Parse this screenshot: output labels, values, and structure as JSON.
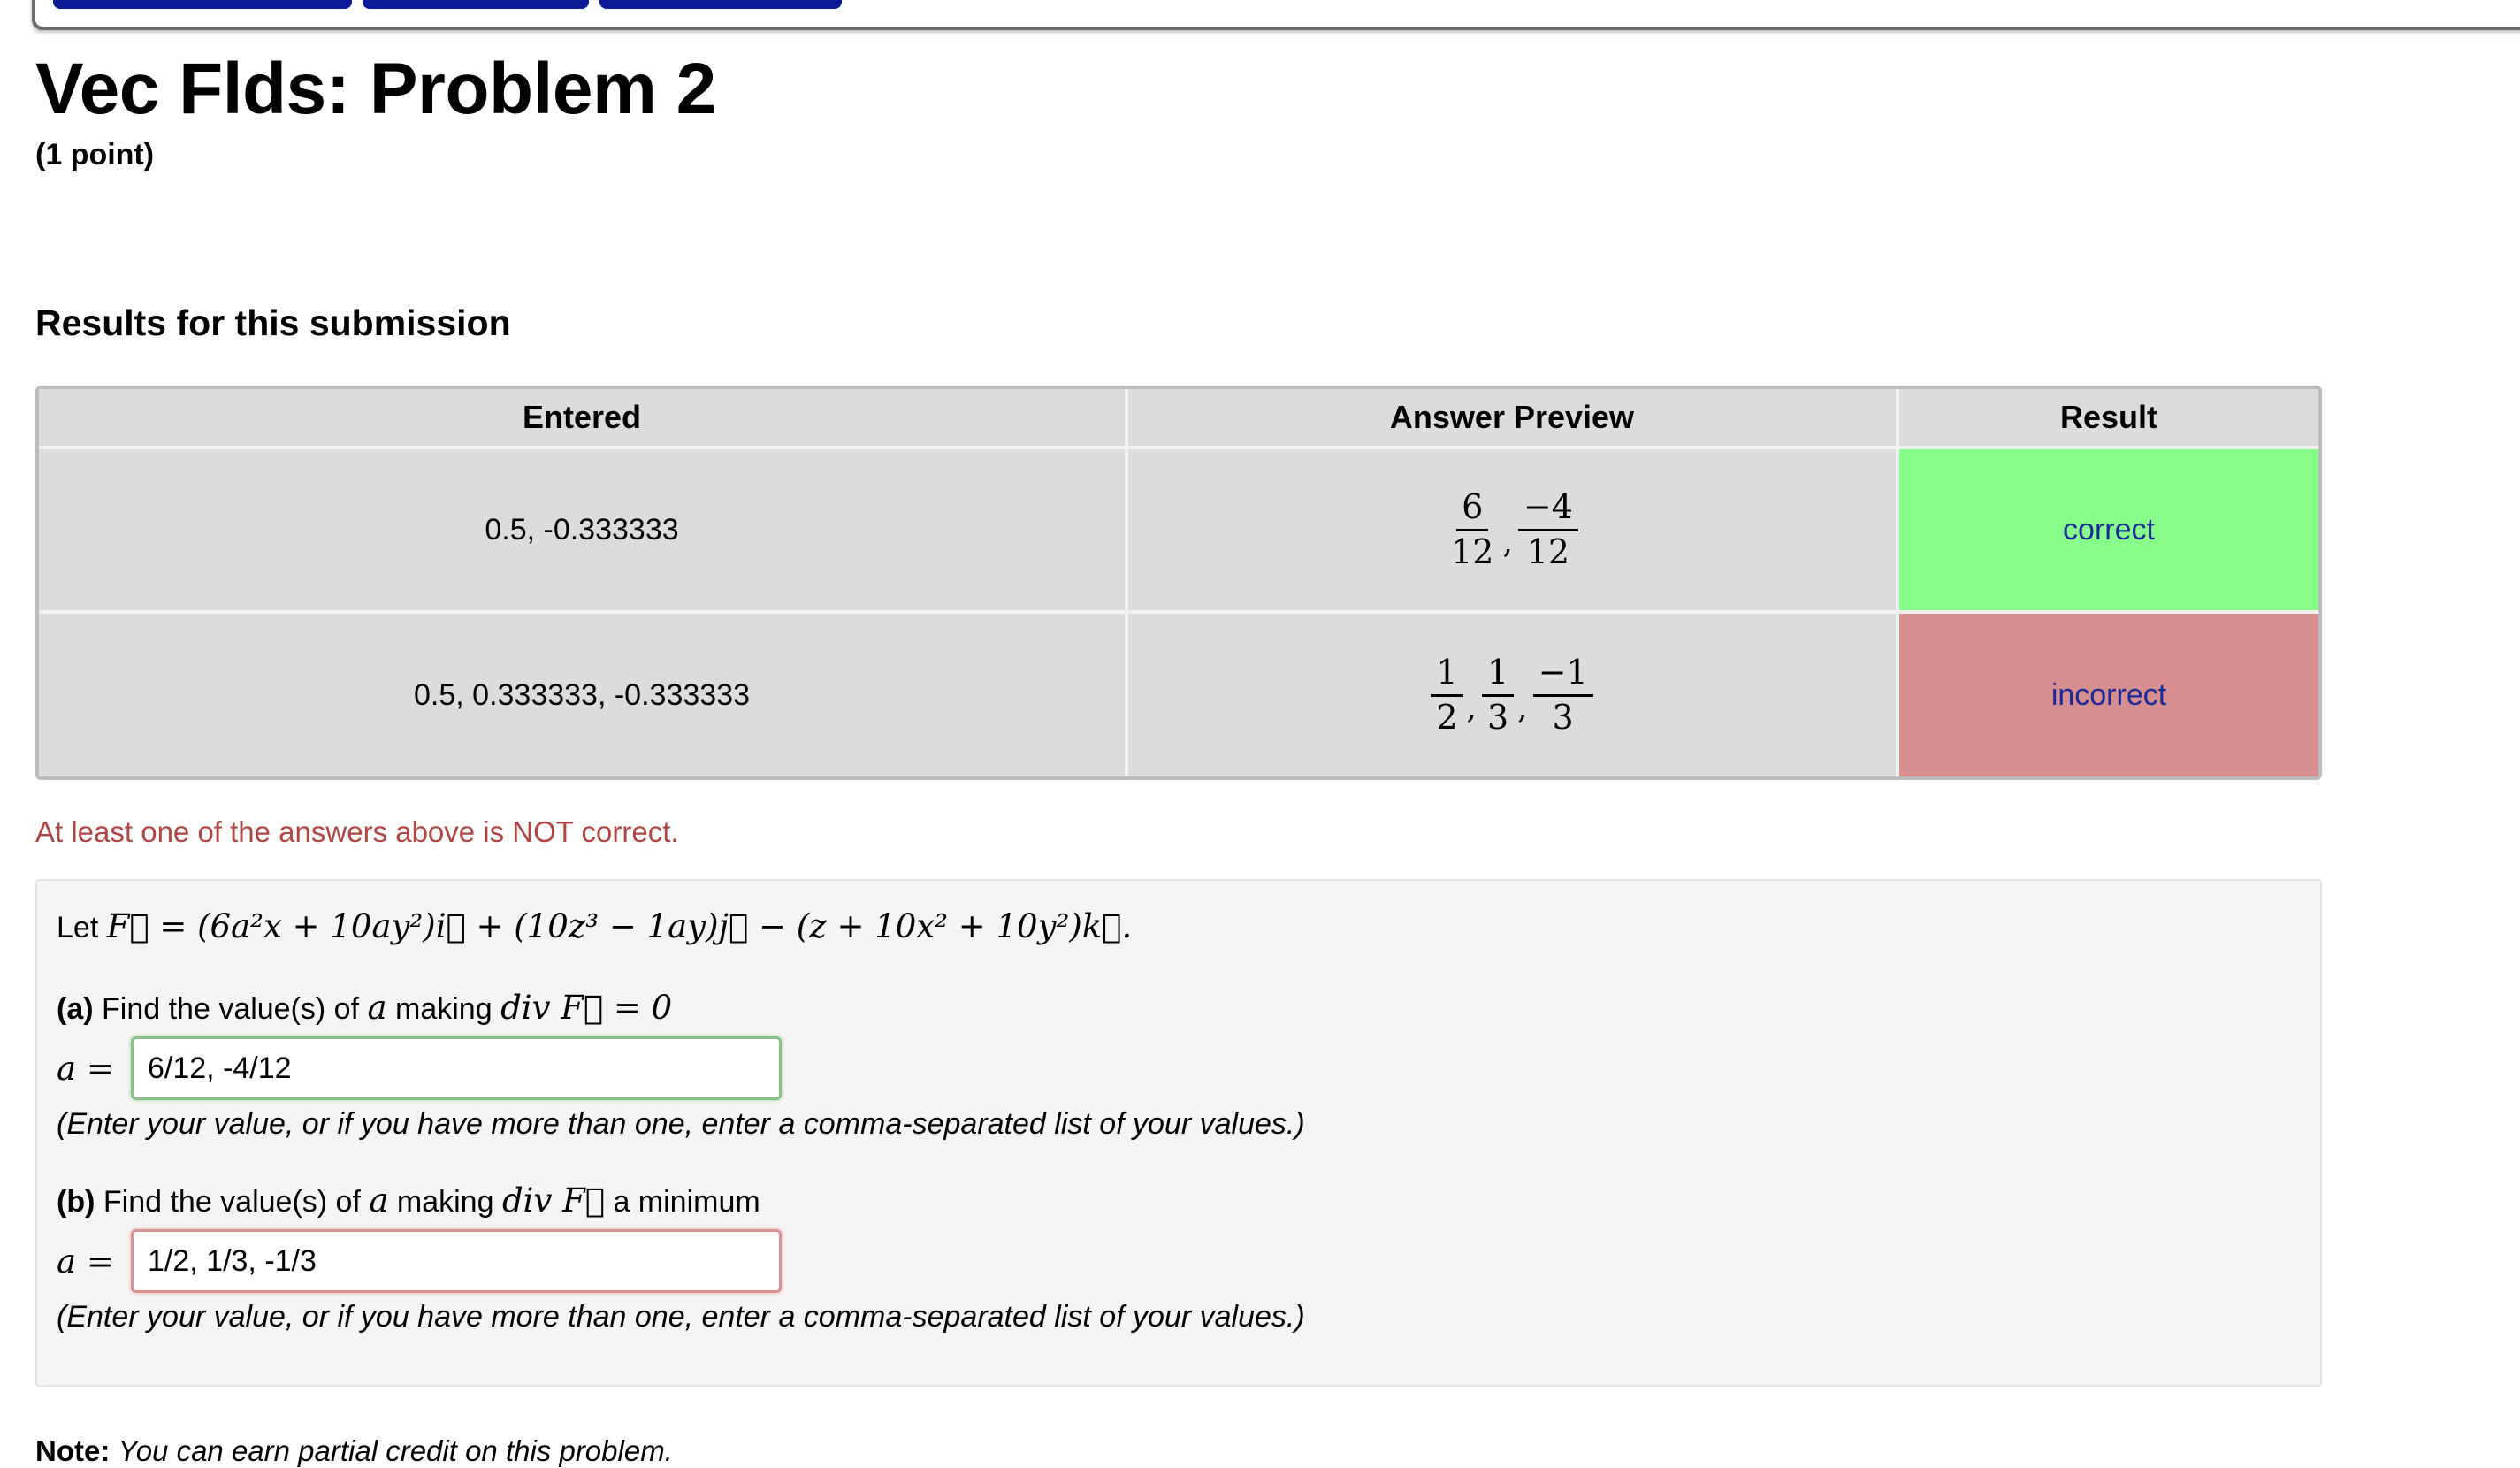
{
  "header": {
    "title": "Vec Flds: Problem 2",
    "points": "(1 point)"
  },
  "results": {
    "heading": "Results for this submission",
    "columns": [
      "Entered",
      "Answer Preview",
      "Result"
    ],
    "rows": [
      {
        "entered": "0.5, -0.333333",
        "preview": [
          [
            "6",
            "12"
          ],
          [
            "−4",
            "12"
          ]
        ],
        "result": "correct"
      },
      {
        "entered": "0.5, 0.333333, -0.333333",
        "preview": [
          [
            "1",
            "2"
          ],
          [
            "1",
            "3"
          ],
          [
            "−1",
            "3"
          ]
        ],
        "result": "incorrect"
      }
    ],
    "warning": "At least one of the answers above is NOT correct."
  },
  "problem": {
    "let_label": "Let",
    "field_expression": "F⃗ = (6a²x + 10ay²)i⃗ + (10z³ − 1ay)j⃗ − (z + 10x² + 10y²)k⃗.",
    "part_a": {
      "tag": "(a)",
      "text_before": "Find the value(s) of",
      "var": "a",
      "text_mid": "making",
      "math": "div F⃗ = 0",
      "text_after": "",
      "answer_label": "a =",
      "answer_value": "6/12, -4/12",
      "hint": "(Enter your value, or if you have more than one, enter a comma-separated list of your values.)"
    },
    "part_b": {
      "tag": "(b)",
      "text_before": "Find the value(s) of",
      "var": "a",
      "text_mid": "making",
      "math": "div F⃗",
      "text_after": "a minimum",
      "answer_label": "a =",
      "answer_value": "1/2, 1/3, -1/3",
      "hint": "(Enter your value, or if you have more than one, enter a comma-separated list of your values.)"
    }
  },
  "note": {
    "label": "Note:",
    "text": "You can earn partial credit on this problem."
  },
  "colors": {
    "correct": "#89fd89",
    "incorrect": "#d68e8e",
    "warning_text": "#b04545",
    "nav_button": "#0a1a96"
  }
}
